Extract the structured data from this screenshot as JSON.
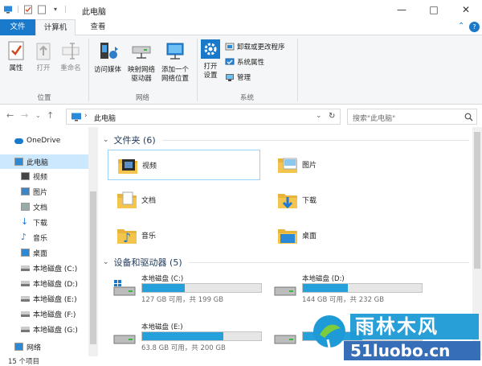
{
  "window": {
    "title": "此电脑",
    "minimize": "—",
    "maximize": "□",
    "close": "✕",
    "help": "?"
  },
  "tabs": {
    "file": "文件",
    "computer": "计算机",
    "view": "查看"
  },
  "ribbon": {
    "location": {
      "label": "位置",
      "properties": "属性",
      "open": "打开",
      "rename": "重命名"
    },
    "network": {
      "label": "网络",
      "access_media": "访问媒体",
      "map_drive_1": "映射网络",
      "map_drive_2": "驱动器",
      "add_location_1": "添加一个",
      "add_location_2": "网络位置"
    },
    "system": {
      "label": "系统",
      "open_settings_1": "打开",
      "open_settings_2": "设置",
      "uninstall": "卸载或更改程序",
      "sys_props": "系统属性",
      "manage": "管理"
    }
  },
  "address": {
    "path": "此电脑",
    "search_placeholder": "搜索\"此电脑\""
  },
  "sidebar": {
    "items": [
      {
        "label": "OneDrive",
        "icon": "cloud-icon"
      },
      {
        "label": "此电脑",
        "icon": "computer-icon"
      },
      {
        "label": "视频",
        "icon": "video-icon"
      },
      {
        "label": "图片",
        "icon": "pictures-icon"
      },
      {
        "label": "文档",
        "icon": "document-icon"
      },
      {
        "label": "下载",
        "icon": "download-icon"
      },
      {
        "label": "音乐",
        "icon": "music-icon"
      },
      {
        "label": "桌面",
        "icon": "desktop-icon"
      },
      {
        "label": "本地磁盘 (C:)",
        "icon": "drive-icon"
      },
      {
        "label": "本地磁盘 (D:)",
        "icon": "drive-icon"
      },
      {
        "label": "本地磁盘 (E:)",
        "icon": "drive-icon"
      },
      {
        "label": "本地磁盘 (F:)",
        "icon": "drive-icon"
      },
      {
        "label": "本地磁盘 (G:)",
        "icon": "drive-icon"
      },
      {
        "label": "网络",
        "icon": "network-icon"
      }
    ]
  },
  "folders": {
    "header": "文件夹 (6)",
    "items": [
      {
        "name": "视频",
        "icon": "video-folder-icon"
      },
      {
        "name": "图片",
        "icon": "pictures-folder-icon"
      },
      {
        "name": "文档",
        "icon": "documents-folder-icon"
      },
      {
        "name": "下载",
        "icon": "downloads-folder-icon"
      },
      {
        "name": "音乐",
        "icon": "music-folder-icon"
      },
      {
        "name": "桌面",
        "icon": "desktop-folder-icon"
      }
    ]
  },
  "drives": {
    "header": "设备和驱动器 (5)",
    "items": [
      {
        "name": "本地磁盘 (C:)",
        "free": "127 GB 可用，共 199 GB",
        "used_fraction": 0.36
      },
      {
        "name": "本地磁盘 (D:)",
        "free": "144 GB 可用，共 232 GB",
        "used_fraction": 0.38
      },
      {
        "name": "本地磁盘 (E:)",
        "free": "63.8 GB 可用，共 200 GB",
        "used_fraction": 0.68
      },
      {
        "name": "",
        "free": "",
        "used_fraction": 0.5
      }
    ]
  },
  "status": {
    "count": "15 个项目"
  },
  "watermark": {
    "brand": "雨林木风",
    "site": "51luobo.cn"
  },
  "colors": {
    "accent": "#1979ca",
    "selection": "#cce8ff",
    "bar": "#26a0da",
    "folder": "#f4c54c"
  }
}
